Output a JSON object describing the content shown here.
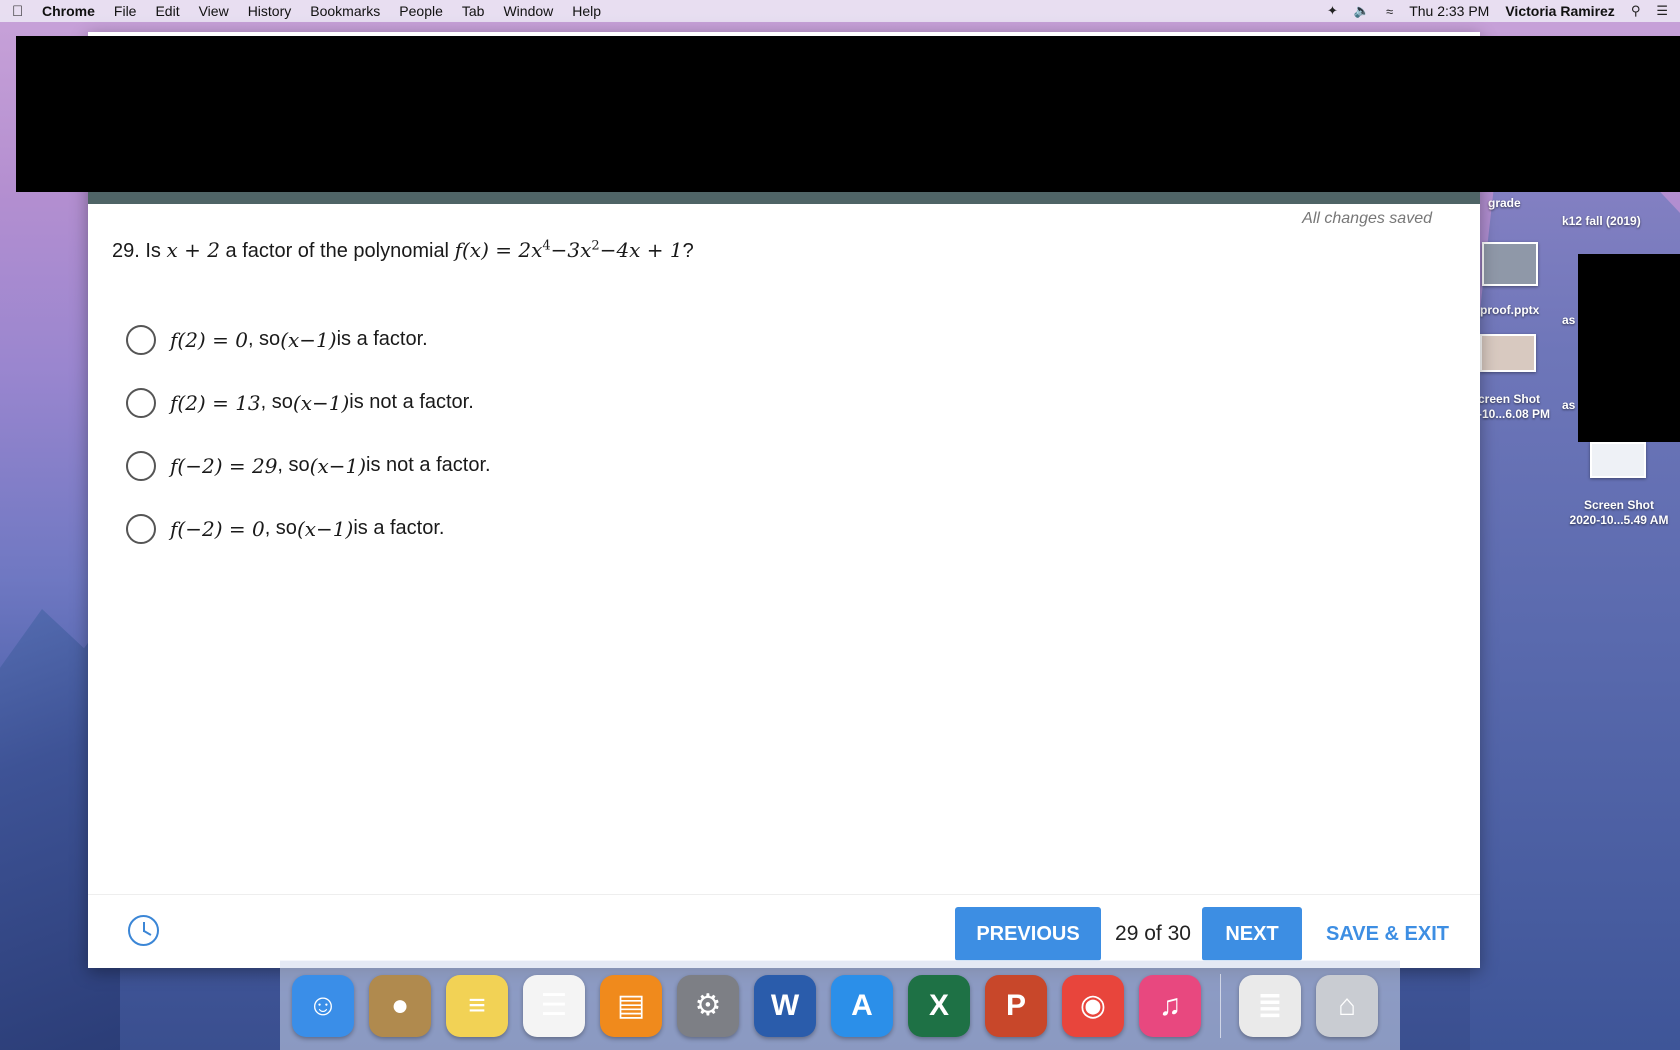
{
  "menubar": {
    "app": "Chrome",
    "items": [
      "File",
      "Edit",
      "View",
      "History",
      "Bookmarks",
      "People",
      "Tab",
      "Window",
      "Help"
    ],
    "clock": "Thu 2:33 PM",
    "user": "Victoria Ramirez"
  },
  "desktop": {
    "labels": {
      "grade": "grade",
      "k12": "k12 fall (2019)",
      "proof": "proof.pptx",
      "as1": "as",
      "as2": "as",
      "screenshot1_line1": "creen Shot",
      "screenshot1_line2": "-10...6.08 PM",
      "screenshot2_line1": "Screen Shot",
      "screenshot2_line2": "2020-10...5.49 AM"
    }
  },
  "quiz": {
    "status": "All changes saved",
    "question": {
      "number": "29.",
      "pre": "Is",
      "factor": "x + 2",
      "mid": "a factor of the polynomial",
      "fx": "f(x)",
      "eq": " = 2x",
      "exp1": "4",
      "t2": "−3x",
      "exp2": "2",
      "t3": "−4x + 1",
      "end": "?"
    },
    "options": [
      {
        "math1": "f(2) = 0",
        "so": ", so ",
        "math2": "(x−1)",
        "tail": " is a factor."
      },
      {
        "math1": "f(2) = 13",
        "so": ", so ",
        "math2": "(x−1)",
        "tail": " is not a factor."
      },
      {
        "math1": "f(−2) = 29",
        "so": ", so ",
        "math2": "(x−1)",
        "tail": " is not a factor."
      },
      {
        "math1": "f(−2) = 0",
        "so": ", so ",
        "math2": "(x−1)",
        "tail": " is a factor."
      }
    ],
    "footer": {
      "previous": "PREVIOUS",
      "counter": "29 of 30",
      "next": "NEXT",
      "save_exit": "SAVE & EXIT"
    }
  },
  "dock": {
    "icons": [
      {
        "name": "finder-icon",
        "glyph": "☺",
        "color": "#3a8ee8"
      },
      {
        "name": "contacts-icon",
        "glyph": "●",
        "color": "#b08a4e"
      },
      {
        "name": "notes-icon",
        "glyph": "≡",
        "color": "#f2d255"
      },
      {
        "name": "reminders-icon",
        "glyph": "☰",
        "color": "#f4f4f4"
      },
      {
        "name": "ibooks-icon",
        "glyph": "▤",
        "color": "#f08a1c"
      },
      {
        "name": "system-preferences-icon",
        "glyph": "⚙",
        "color": "#7d7f85"
      },
      {
        "name": "word-icon",
        "glyph": "W",
        "color": "#2a5cab"
      },
      {
        "name": "app-store-icon",
        "glyph": "A",
        "color": "#2b8fe9"
      },
      {
        "name": "excel-icon",
        "glyph": "X",
        "color": "#1e7145"
      },
      {
        "name": "powerpoint-icon",
        "glyph": "P",
        "color": "#c8472a"
      },
      {
        "name": "chrome-icon",
        "glyph": "◉",
        "color": "#e8453c"
      },
      {
        "name": "itunes-icon",
        "glyph": "♫",
        "color": "#e8487f"
      },
      {
        "name": "document-icon",
        "glyph": "≣",
        "color": "#eaeaea"
      },
      {
        "name": "trash-icon",
        "glyph": "⌂",
        "color": "#c9ccd2"
      }
    ]
  }
}
